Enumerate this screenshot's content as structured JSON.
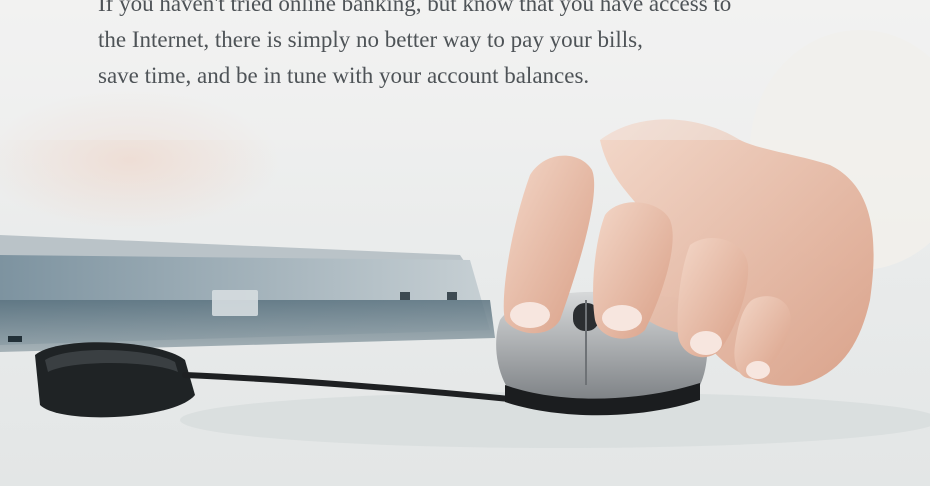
{
  "intro": {
    "lines": [
      "If you haven't tried online banking, but know that you have access to",
      "the Internet, there is simply no better way to pay your bills,",
      "save time, and be in tune with your account balances."
    ]
  },
  "hero_image": {
    "description_icon": "hand-on-mouse-photo",
    "colors": {
      "background": "#eceeee",
      "laptop": "#6f8591",
      "mouse": "#9fa3a6",
      "skin": "#e9c2ad",
      "cable": "#1e2022"
    }
  }
}
